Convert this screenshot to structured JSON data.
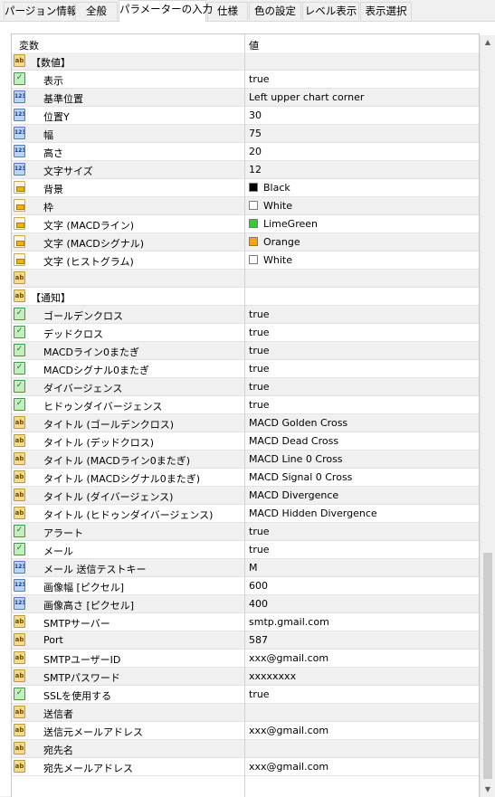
{
  "tabs": [
    "パージョン情報",
    "全般",
    "パラメーターの入力",
    "仕様",
    "色の設定",
    "レベル表示",
    "表示選択"
  ],
  "active_tab": 2,
  "grid": {
    "col_variable": "変数",
    "col_value": "値"
  },
  "rows": [
    {
      "icon": "ab",
      "name": "【数値】",
      "value": "",
      "indent": false
    },
    {
      "icon": "bool",
      "name": "表示",
      "value": "true",
      "indent": true
    },
    {
      "icon": "123",
      "name": "基準位置",
      "value": "Left upper chart corner",
      "indent": true
    },
    {
      "icon": "123",
      "name": "位置Y",
      "value": "30",
      "indent": true
    },
    {
      "icon": "123",
      "name": "幅",
      "value": "75",
      "indent": true
    },
    {
      "icon": "123",
      "name": "高さ",
      "value": "20",
      "indent": true
    },
    {
      "icon": "123",
      "name": "文字サイズ",
      "value": "12",
      "indent": true
    },
    {
      "icon": "color",
      "name": "背景",
      "value": "Black",
      "swatch": "#000000",
      "indent": true
    },
    {
      "icon": "color",
      "name": "枠",
      "value": "White",
      "swatch": "#ffffff",
      "indent": true
    },
    {
      "icon": "color",
      "name": "文字 (MACDライン)",
      "value": "LimeGreen",
      "swatch": "#32cd32",
      "indent": true
    },
    {
      "icon": "color",
      "name": "文字 (MACDシグナル)",
      "value": "Orange",
      "swatch": "#ffa500",
      "indent": true
    },
    {
      "icon": "color",
      "name": "文字 (ヒストグラム)",
      "value": "White",
      "swatch": "#ffffff",
      "indent": true
    },
    {
      "icon": "ab",
      "name": "",
      "value": "",
      "indent": true
    },
    {
      "icon": "ab",
      "name": "【通知】",
      "value": "",
      "indent": false
    },
    {
      "icon": "bool",
      "name": "ゴールデンクロス",
      "value": "true",
      "indent": true
    },
    {
      "icon": "bool",
      "name": "デッドクロス",
      "value": "true",
      "indent": true
    },
    {
      "icon": "bool",
      "name": "MACDライン0またぎ",
      "value": "true",
      "indent": true
    },
    {
      "icon": "bool",
      "name": "MACDシグナル0またぎ",
      "value": "true",
      "indent": true
    },
    {
      "icon": "bool",
      "name": "ダイバージェンス",
      "value": "true",
      "indent": true
    },
    {
      "icon": "bool",
      "name": "ヒドゥンダイバージェンス",
      "value": "true",
      "indent": true
    },
    {
      "icon": "ab",
      "name": "タイトル (ゴールデンクロス)",
      "value": "MACD Golden Cross",
      "indent": true
    },
    {
      "icon": "ab",
      "name": "タイトル (デッドクロス)",
      "value": "MACD Dead Cross",
      "indent": true
    },
    {
      "icon": "ab",
      "name": "タイトル (MACDライン0またぎ)",
      "value": "MACD Line 0 Cross",
      "indent": true
    },
    {
      "icon": "ab",
      "name": "タイトル (MACDシグナル0またぎ)",
      "value": "MACD Signal 0 Cross",
      "indent": true
    },
    {
      "icon": "ab",
      "name": "タイトル (ダイバージェンス)",
      "value": "MACD Divergence",
      "indent": true
    },
    {
      "icon": "ab",
      "name": "タイトル (ヒドゥンダイバージェンス)",
      "value": "MACD Hidden Divergence",
      "indent": true
    },
    {
      "icon": "bool",
      "name": "アラート",
      "value": "true",
      "indent": true
    },
    {
      "icon": "bool",
      "name": "メール",
      "value": "true",
      "indent": true
    },
    {
      "icon": "123",
      "name": "メール 送信テストキー",
      "value": "M",
      "indent": true
    },
    {
      "icon": "123",
      "name": "画像幅 [ピクセル]",
      "value": "600",
      "indent": true
    },
    {
      "icon": "123",
      "name": "画像高さ [ピクセル]",
      "value": "400",
      "indent": true
    },
    {
      "icon": "ab",
      "name": "SMTPサーバー",
      "value": "smtp.gmail.com",
      "indent": true
    },
    {
      "icon": "ab",
      "name": "Port",
      "value": "587",
      "indent": true
    },
    {
      "icon": "ab",
      "name": "SMTPユーザーID",
      "value": "xxx@gmail.com",
      "indent": true
    },
    {
      "icon": "ab",
      "name": "SMTPパスワード",
      "value": "xxxxxxxx",
      "indent": true
    },
    {
      "icon": "bool",
      "name": "SSLを使用する",
      "value": "true",
      "indent": true
    },
    {
      "icon": "ab",
      "name": "送信者",
      "value": "",
      "indent": true
    },
    {
      "icon": "ab",
      "name": "送信元メールアドレス",
      "value": "xxx@gmail.com",
      "indent": true
    },
    {
      "icon": "ab",
      "name": "宛先名",
      "value": "",
      "indent": true
    },
    {
      "icon": "ab",
      "name": "宛先メールアドレス",
      "value": "xxx@gmail.com",
      "indent": true
    }
  ],
  "icons": {
    "ab": "text-param-icon",
    "123": "number-param-icon",
    "bool": "bool-param-icon",
    "color": "color-param-icon"
  },
  "scrollbar": {
    "up_glyph": "▲",
    "down_glyph": "▼",
    "position": 0.65
  }
}
